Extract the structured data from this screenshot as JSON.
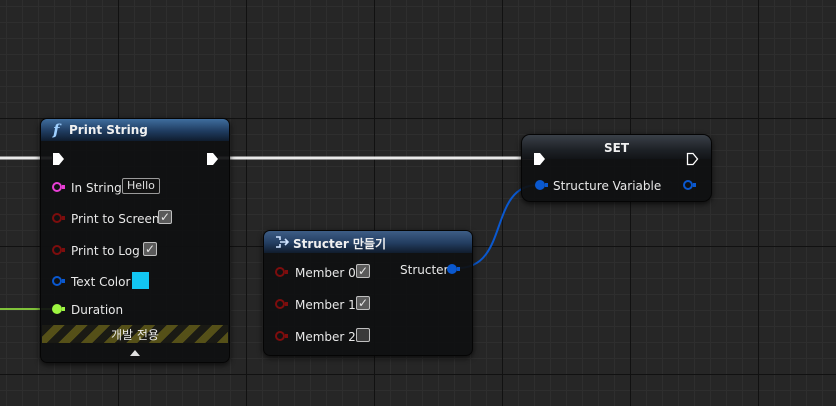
{
  "colors": {
    "exec_wire": "#ffffff",
    "string_pin": "#e93ed6",
    "bool_pin": "#7d0d0d",
    "struct_pin": "#0a58cf",
    "float_pin": "#9df541",
    "textcolor_swatch": "#12c6f2"
  },
  "print_string": {
    "title": "Print String",
    "title_icon": "function-icon",
    "title_glyph": "f",
    "pins": {
      "in_string": {
        "label": "In String",
        "value": "Hello"
      },
      "print_to_screen": {
        "label": "Print to Screen",
        "checked": true
      },
      "print_to_log": {
        "label": "Print to Log",
        "checked": true
      },
      "text_color": {
        "label": "Text Color"
      },
      "duration": {
        "label": "Duration"
      }
    },
    "dev_only_label": "개발 전용",
    "expand_icon": "collapse-arrow-icon"
  },
  "make_struct": {
    "title": "Structer 만들기",
    "title_icon": "make-struct-icon",
    "members": [
      {
        "label": "Member 0",
        "checked": true
      },
      {
        "label": "Member 1",
        "checked": true
      },
      {
        "label": "Member 2",
        "checked": false
      }
    ],
    "output_label": "Structer"
  },
  "set_node": {
    "title": "SET",
    "variable_label": "Structure Variable"
  }
}
